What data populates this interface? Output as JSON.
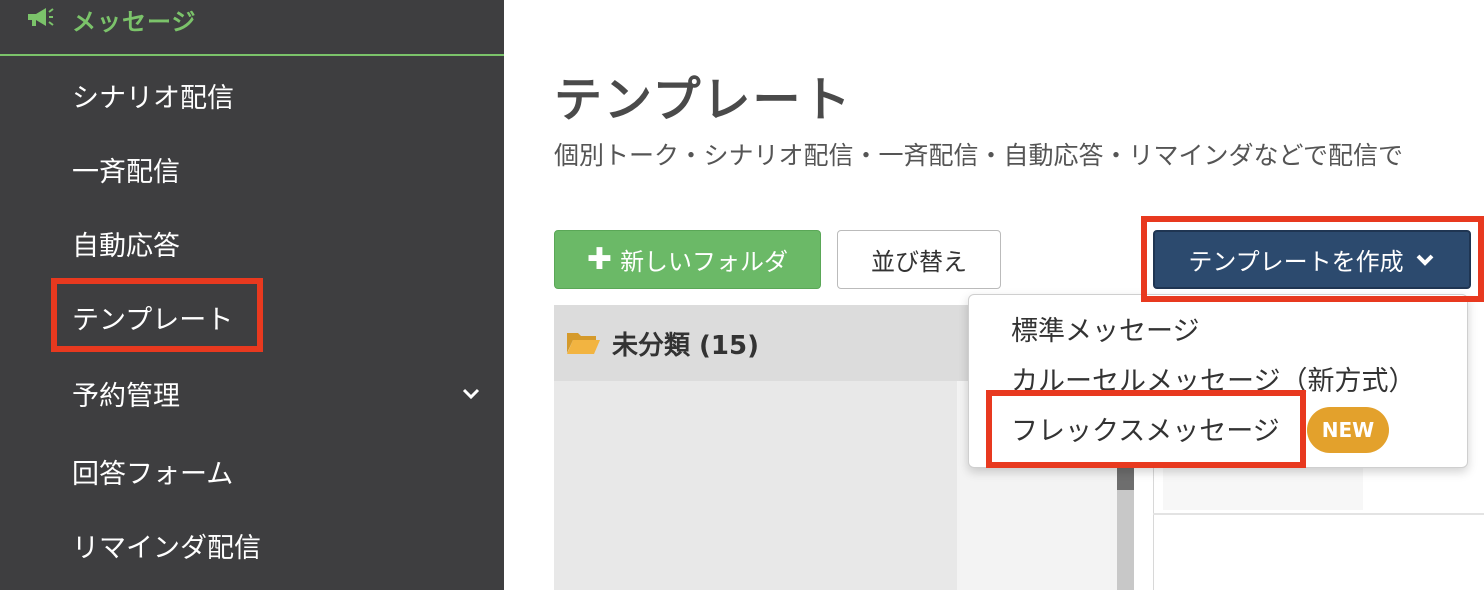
{
  "sidebar": {
    "header_label": "メッセージ",
    "header_icon": "megaphone-icon",
    "items": [
      {
        "label": "シナリオ配信"
      },
      {
        "label": "一斉配信"
      },
      {
        "label": "自動応答"
      },
      {
        "label": "テンプレート"
      },
      {
        "label": "予約管理",
        "has_chevron": true
      },
      {
        "label": "回答フォーム"
      },
      {
        "label": "リマインダ配信"
      }
    ],
    "accent_color": "#7bc36a",
    "background_color": "#3e3e40"
  },
  "main": {
    "title": "テンプレート",
    "description": "個別トーク・シナリオ配信・一斉配信・自動応答・リマインダなどで配信で",
    "toolbar": {
      "new_folder_label": "新しいフォルダ",
      "new_folder_icon": "plus-icon",
      "sort_label": "並び替え",
      "create_label": "テンプレートを作成",
      "create_icon": "chevron-down-icon"
    },
    "folder": {
      "icon": "folder-open-icon",
      "label": "未分類 (15)"
    },
    "dropdown": {
      "items": [
        {
          "label": "標準メッセージ"
        },
        {
          "label": "カルーセルメッセージ（新方式）"
        },
        {
          "label": "フレックスメッセージ",
          "badge": "NEW"
        }
      ]
    }
  },
  "colors": {
    "highlight": "#e8391f",
    "green_button": "#6bb967",
    "navy_button": "#2c4a6e",
    "new_badge": "#e3a12c"
  }
}
